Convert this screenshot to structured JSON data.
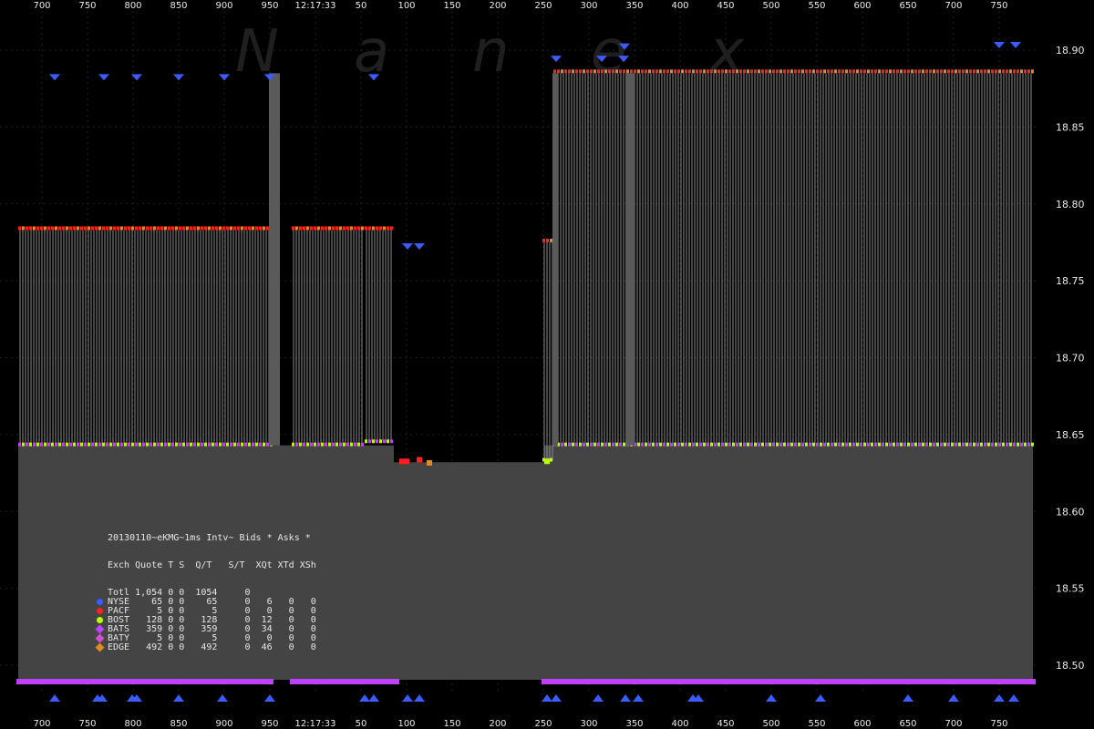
{
  "chart_data": {
    "type": "line",
    "title": "",
    "ylabel": "",
    "xlabel": "",
    "ylim": [
      18.48,
      18.92
    ],
    "yticks": [
      "18.90",
      "18.85",
      "18.80",
      "18.75",
      "18.70",
      "18.65",
      "18.60",
      "18.55",
      "18.50"
    ],
    "xticks": [
      "700",
      "750",
      "800",
      "850",
      "900",
      "950",
      "12:17:33",
      "50",
      "100",
      "150",
      "200",
      "250",
      "300",
      "350",
      "400",
      "450",
      "500",
      "550",
      "600",
      "650",
      "700",
      "750"
    ],
    "watermark": [
      "N",
      "a",
      "n",
      "e",
      "x"
    ],
    "segments": [
      {
        "from": 20,
        "to": 300,
        "ask": 18.783,
        "bid": 18.643
      },
      {
        "from": 320,
        "to": 400,
        "ask": 18.783,
        "bid": 18.643
      },
      {
        "from": 400,
        "to": 432,
        "ask": 18.783,
        "bid": 18.645
      },
      {
        "from": 432,
        "to": 595,
        "ask": null,
        "bid": 18.632
      },
      {
        "from": 595,
        "to": 607,
        "ask": 18.775,
        "bid": 18.633
      },
      {
        "from": 607,
        "to": 1133,
        "ask": 18.885,
        "bid": 18.643
      }
    ],
    "nbbo_gray": [
      {
        "from": 20,
        "to": 307,
        "value": 18.643
      },
      {
        "from": 307,
        "to": 432,
        "value": 18.643
      },
      {
        "from": 432,
        "to": 597,
        "value": 18.632
      },
      {
        "from": 597,
        "to": 1133,
        "value": 18.643
      }
    ],
    "nyse_ask_markers": [
      {
        "x": 60,
        "y": 18.882
      },
      {
        "x": 114,
        "y": 18.882
      },
      {
        "x": 150,
        "y": 18.882
      },
      {
        "x": 196,
        "y": 18.882
      },
      {
        "x": 246,
        "y": 18.882
      },
      {
        "x": 296,
        "y": 18.882
      },
      {
        "x": 410,
        "y": 18.882
      },
      {
        "x": 447,
        "y": 18.772
      },
      {
        "x": 460,
        "y": 18.772
      },
      {
        "x": 610,
        "y": 18.894
      },
      {
        "x": 660,
        "y": 18.894
      },
      {
        "x": 684,
        "y": 18.894
      },
      {
        "x": 685,
        "y": 18.902
      },
      {
        "x": 1096,
        "y": 18.903
      },
      {
        "x": 1114,
        "y": 18.903
      }
    ],
    "stats": {
      "header": "20130110~eKMG~1ms Intv~ Bids * Asks *",
      "columns": "Exch Quote T S  Q/T   S/T  XQt XTd XSh",
      "rows": [
        {
          "exch": "Totl",
          "text": "Totl 1,054 0 0  1054     0",
          "color": ""
        },
        {
          "exch": "NYSE",
          "text": "NYSE    65 0 0    65     0   6   0   0",
          "color": "#3a5cff"
        },
        {
          "exch": "PACF",
          "text": "PACF     5 0 0     5     0   0   0   0",
          "color": "#ff2020"
        },
        {
          "exch": "BOST",
          "text": "BOST   128 0 0   128     0  12   0   0",
          "color": "#b8ff00"
        },
        {
          "exch": "BATS",
          "text": "BATS   359 0 0   359     0  34   0   0",
          "color": "#c040ff"
        },
        {
          "exch": "BATY",
          "text": "BATY     5 0 0     5     0   0   0   0",
          "color": "#d050d0"
        },
        {
          "exch": "EDGE",
          "text": "EDGE   492 0 0   492     0  46   0   0",
          "color": "#e08a20"
        }
      ]
    },
    "colors": {
      "nbbo_fill": "#444444",
      "ask_line": "#8c8c8c",
      "nyse": "#3a5cff",
      "pacf": "#ff2020",
      "bost": "#b8ff00",
      "bats": "#c040ff",
      "edge": "#e08a20"
    }
  }
}
